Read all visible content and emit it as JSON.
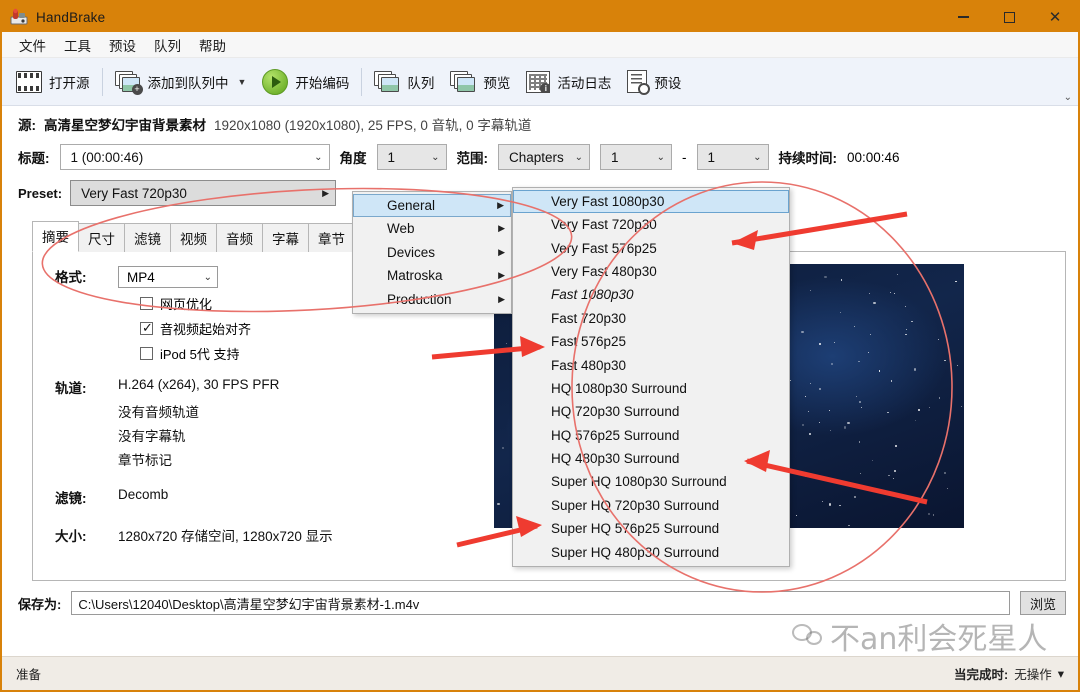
{
  "window": {
    "title": "HandBrake",
    "icon": "handbrake-icon",
    "minimize": "–",
    "maximize": "□",
    "close": "✕"
  },
  "menubar": {
    "items": [
      {
        "label": "文件",
        "name": "menu-file"
      },
      {
        "label": "工具",
        "name": "menu-tools"
      },
      {
        "label": "预设",
        "name": "menu-presets"
      },
      {
        "label": "队列",
        "name": "menu-queue"
      },
      {
        "label": "帮助",
        "name": "menu-help"
      }
    ]
  },
  "toolbar": {
    "open_source": "打开源",
    "add_to_queue": "添加到队列中",
    "start_encode": "开始编码",
    "queue": "队列",
    "preview": "预览",
    "activity_log": "活动日志",
    "presets": "预设",
    "caret": "▼",
    "overflow": "⌄"
  },
  "source": {
    "label": "源:",
    "name": "高清星空梦幻宇宙背景素材",
    "meta": "1920x1080 (1920x1080), 25 FPS, 0 音轨, 0 字幕轨道"
  },
  "title_row": {
    "title_label": "标题:",
    "title_value": "1  (00:00:46)",
    "angle_label": "角度",
    "angle_value": "1",
    "range_label": "范围:",
    "range_value": "Chapters",
    "chapter_start": "1",
    "dash": "-",
    "chapter_end": "1",
    "duration_label": "持续时间:",
    "duration_value": "00:00:46",
    "caret": "⌄"
  },
  "preset": {
    "label": "Preset:",
    "value": "Very Fast 720p30",
    "arrow": "▶"
  },
  "tabs": [
    {
      "label": "摘要",
      "name": "tab-summary",
      "active": true
    },
    {
      "label": "尺寸",
      "name": "tab-dimensions",
      "active": false
    },
    {
      "label": "滤镜",
      "name": "tab-filters",
      "active": false
    },
    {
      "label": "视频",
      "name": "tab-video",
      "active": false
    },
    {
      "label": "音频",
      "name": "tab-audio",
      "active": false
    },
    {
      "label": "字幕",
      "name": "tab-subtitles",
      "active": false
    },
    {
      "label": "章节",
      "name": "tab-chapters",
      "active": false
    }
  ],
  "summary": {
    "format_label": "格式:",
    "format_value": "MP4",
    "format_caret": "⌄",
    "checkbox_web_optimized": {
      "label": "网页优化",
      "checked": false
    },
    "checkbox_align_av": {
      "label": "音视频起始对齐",
      "checked": true
    },
    "checkbox_ipod": {
      "label": "iPod 5代 支持",
      "checked": false
    },
    "tracks_label": "轨道:",
    "track_video": "H.264 (x264), 30 FPS PFR",
    "track_audio": "没有音频轨道",
    "track_subtitle": "没有字幕轨",
    "track_chapters": "章节标记",
    "filters_label": "滤镜:",
    "filters_value": "Decomb",
    "size_label": "大小:",
    "size_value": "1280x720 存储空间, 1280x720 显示"
  },
  "preview_nav": {
    "prev": "‹",
    "next": "›"
  },
  "preset_menu_level1": [
    {
      "label": "General",
      "submenu_arrow": "▶",
      "highlighted": true
    },
    {
      "label": "Web",
      "submenu_arrow": "▶",
      "highlighted": false
    },
    {
      "label": "Devices",
      "submenu_arrow": "▶",
      "highlighted": false
    },
    {
      "label": "Matroska",
      "submenu_arrow": "▶",
      "highlighted": false
    },
    {
      "label": "Production",
      "submenu_arrow": "▶",
      "highlighted": false
    }
  ],
  "preset_menu_level2": [
    {
      "label": "Very Fast 1080p30",
      "highlighted": true,
      "italic": false
    },
    {
      "label": "Very Fast 720p30",
      "highlighted": false,
      "italic": false
    },
    {
      "label": "Very Fast 576p25",
      "highlighted": false,
      "italic": false
    },
    {
      "label": "Very Fast 480p30",
      "highlighted": false,
      "italic": false
    },
    {
      "label": "Fast 1080p30",
      "highlighted": false,
      "italic": true
    },
    {
      "label": "Fast 720p30",
      "highlighted": false,
      "italic": false
    },
    {
      "label": "Fast 576p25",
      "highlighted": false,
      "italic": false
    },
    {
      "label": "Fast 480p30",
      "highlighted": false,
      "italic": false
    },
    {
      "label": "HQ 1080p30 Surround",
      "highlighted": false,
      "italic": false
    },
    {
      "label": "HQ 720p30 Surround",
      "highlighted": false,
      "italic": false
    },
    {
      "label": "HQ 576p25 Surround",
      "highlighted": false,
      "italic": false
    },
    {
      "label": "HQ 480p30 Surround",
      "highlighted": false,
      "italic": false
    },
    {
      "label": "Super HQ 1080p30 Surround",
      "highlighted": false,
      "italic": false
    },
    {
      "label": "Super HQ 720p30 Surround",
      "highlighted": false,
      "italic": false
    },
    {
      "label": "Super HQ 576p25 Surround",
      "highlighted": false,
      "italic": false
    },
    {
      "label": "Super HQ 480p30 Surround",
      "highlighted": false,
      "italic": false
    }
  ],
  "save": {
    "label": "保存为:",
    "path": "C:\\Users\\12040\\Desktop\\高清星空梦幻宇宙背景素材-1.m4v",
    "browse": "浏览"
  },
  "statusbar": {
    "status": "准备",
    "when_done_label": "当完成时:",
    "when_done_value": "无操作",
    "caret": "▾"
  },
  "watermark": {
    "text": "不an利会死星人"
  },
  "colors": {
    "titlebar": "#d8820a",
    "toolbar": "#eff3fa",
    "menu_highlight": "#cfe6f7",
    "annotation_red": "#e8443a",
    "ellipse_red": "#e8716b"
  }
}
